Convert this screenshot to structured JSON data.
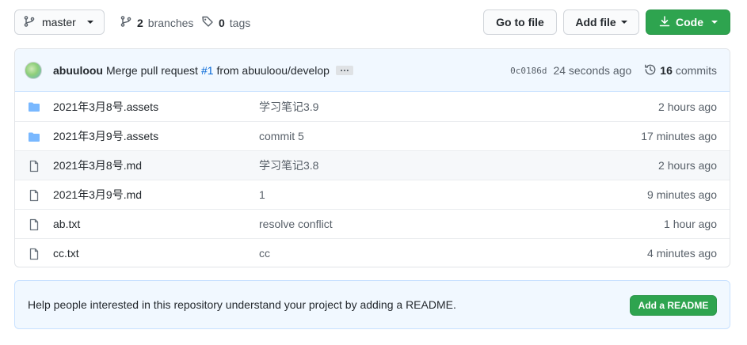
{
  "toolbar": {
    "branch_label": "master",
    "branches_count": "2",
    "branches_label": "branches",
    "tags_count": "0",
    "tags_label": "tags",
    "goto_label": "Go to file",
    "addfile_label": "Add file",
    "code_label": "Code"
  },
  "commit": {
    "author": "abuuloou",
    "message_prefix": "Merge pull request",
    "pr_number": "#1",
    "message_suffix": "from abuuloou/develop",
    "ellipsis": "…",
    "sha": "0c0186d",
    "age": "24 seconds ago",
    "commits_count": "16",
    "commits_label": "commits"
  },
  "files": [
    {
      "type": "folder",
      "icon": "folder-icon",
      "name": "2021年3月8号.assets",
      "message": "学习笔记3.9",
      "age": "2 hours ago"
    },
    {
      "type": "folder",
      "icon": "folder-icon",
      "name": "2021年3月9号.assets",
      "message": "commit 5",
      "age": "17 minutes ago"
    },
    {
      "type": "file",
      "icon": "file-icon",
      "name": "2021年3月8号.md",
      "message": "学习笔记3.8",
      "age": "2 hours ago"
    },
    {
      "type": "file",
      "icon": "file-icon",
      "name": "2021年3月9号.md",
      "message": "1",
      "age": "9 minutes ago"
    },
    {
      "type": "file",
      "icon": "file-icon",
      "name": "ab.txt",
      "message": "resolve conflict",
      "age": "1 hour ago"
    },
    {
      "type": "file",
      "icon": "file-icon",
      "name": "cc.txt",
      "message": "cc",
      "age": "4 minutes ago"
    }
  ],
  "readme": {
    "text": "Help people interested in this repository understand your project by adding a README.",
    "button_label": "Add a README"
  },
  "colors": {
    "accent_green": "#2ea44f",
    "link_blue": "#0366d6",
    "folder_blue": "#79b8ff",
    "banner_bg": "#f1f8ff"
  }
}
